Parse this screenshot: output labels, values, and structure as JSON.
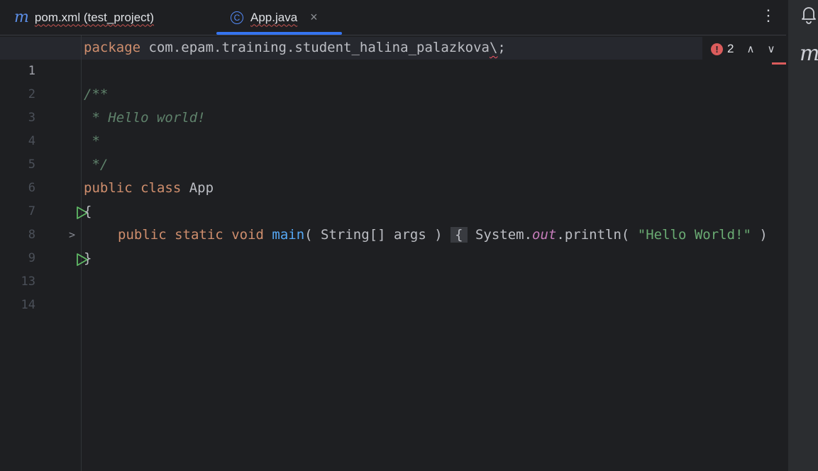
{
  "tabs": [
    {
      "icon": "maven-icon",
      "icon_text": "m",
      "label": "pom.xml (test_project)"
    },
    {
      "icon": "class-icon",
      "icon_text": "C",
      "label": "App.java",
      "active": true
    }
  ],
  "tab_close_glyph": "×",
  "more_glyph": "⋮",
  "maven_glyph": "m",
  "error_indicator": {
    "count": "2",
    "up": "∧",
    "down": "∨",
    "icon": "!"
  },
  "fold_chevron": ">",
  "lines": [
    {
      "n": "1",
      "parts": [
        "package",
        " com.epam.training.student_halina_palazkova",
        "\\",
        ";"
      ]
    },
    {
      "n": "2"
    },
    {
      "n": "3",
      "text": "/**"
    },
    {
      "n": "4",
      "text": " * Hello world!"
    },
    {
      "n": "5",
      "text": " *"
    },
    {
      "n": "6",
      "text": " */"
    },
    {
      "n": "7",
      "parts": [
        "public",
        " ",
        "class",
        " App"
      ]
    },
    {
      "n": "8",
      "text": "{"
    },
    {
      "n": "9",
      "parts": [
        "public",
        " ",
        "static",
        " ",
        "void",
        " ",
        "main",
        "( String[] args ) ",
        "{",
        " System.",
        "out",
        ".println( ",
        "\"Hello World!\"",
        " )"
      ]
    },
    {
      "n": "13",
      "text": "}"
    },
    {
      "n": "14"
    }
  ],
  "colors": {
    "keyword": "#cf8e6d",
    "comment": "#5f826b",
    "function": "#56a8f5",
    "string": "#6aab73",
    "field": "#c77dbb",
    "accent": "#3574f0",
    "error": "#db5c5c"
  }
}
